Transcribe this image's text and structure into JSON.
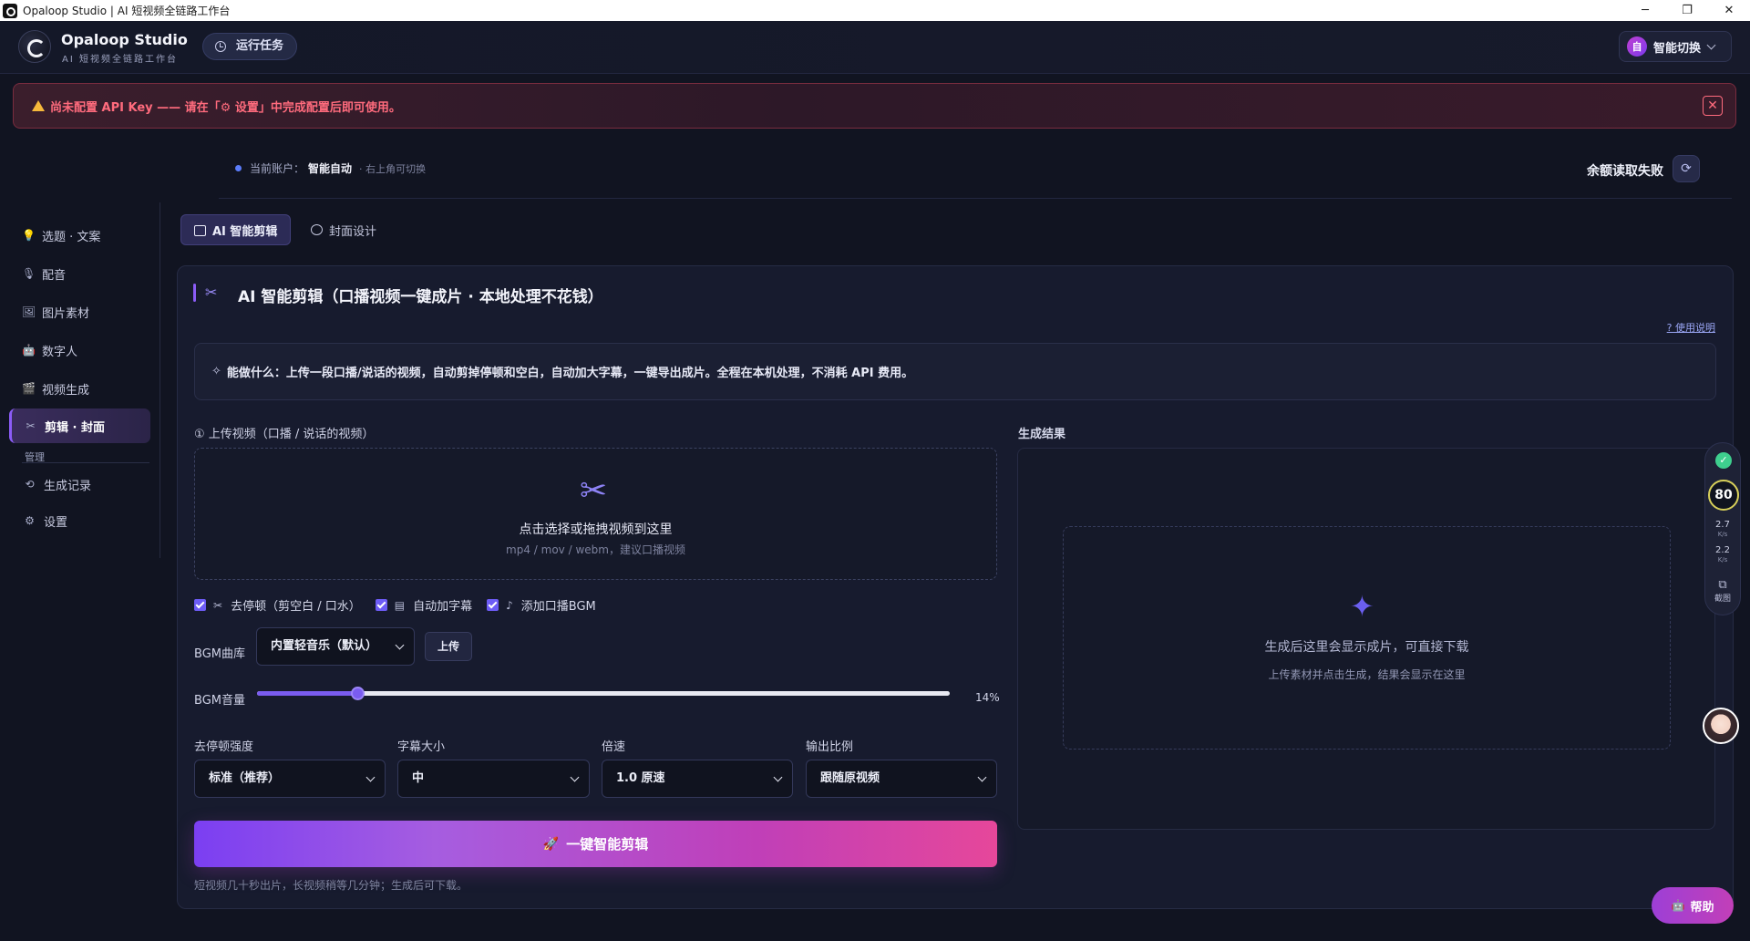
{
  "window": {
    "title": "Opaloop Studio | AI 短视频全链路工作台",
    "controls": [
      "─",
      "❐",
      "✕"
    ]
  },
  "header": {
    "brand_name": "Opaloop Studio",
    "brand_sub": "AI 短视频全链路工作台",
    "run_task": "运行任务",
    "account_badge": "自",
    "account_switch": "智能切换"
  },
  "alert": {
    "text": "尚未配置 API Key —— 请在「⚙ 设置」中完成配置后即可使用。",
    "close": "✕"
  },
  "account_bar": {
    "label": "当前账户：",
    "name": "智能自动",
    "hint": "· 右上角可切换",
    "balance": "余额读取失败",
    "refresh": "⟳"
  },
  "sidebar": {
    "items": [
      {
        "label": "选题 · 文案",
        "icon": "💡"
      },
      {
        "label": "配音",
        "icon": "🎙"
      },
      {
        "label": "图片素材",
        "icon": "🖼"
      },
      {
        "label": "数字人",
        "icon": "🤖"
      },
      {
        "label": "视频生成",
        "icon": "🎬"
      },
      {
        "label": "剪辑 · 封面",
        "icon": "✂"
      }
    ],
    "section": "管理",
    "manage_items": [
      {
        "label": "生成记录",
        "icon": "⟲"
      },
      {
        "label": "设置",
        "icon": "⚙"
      }
    ]
  },
  "tabs": [
    {
      "label": "AI 智能剪辑"
    },
    {
      "label": "封面设计"
    }
  ],
  "panel": {
    "title": "AI 智能剪辑（口播视频一键成片 · 本地处理不花钱）",
    "help_link": "? 使用说明",
    "info": "能做什么：上传一段口播/说话的视频，自动剪掉停顿和空白，自动加大字幕，一键导出成片。全程在本机处理，不消耗 API 费用。",
    "upload_label": "① 上传视频（口播 / 说话的视频）",
    "upload_main": "点击选择或拖拽视频到这里",
    "upload_sub": "mp4 / mov / webm，建议口播视频",
    "checks": [
      {
        "label": "去停顿（剪空白 / 口水）",
        "checked": true
      },
      {
        "label": "自动加字幕",
        "checked": true
      },
      {
        "label": "添加口播BGM",
        "checked": true
      }
    ],
    "bgm_label": "BGM曲库",
    "bgm_select": "内置轻音乐（默认）",
    "bgm_upload": "上传",
    "volume_label": "BGM音量",
    "volume_value": "14%",
    "volume_fraction": 0.145,
    "params": [
      {
        "label": "去停顿强度",
        "value": "标准（推荐）"
      },
      {
        "label": "字幕大小",
        "value": "中"
      },
      {
        "label": "倍速",
        "value": "1.0 原速"
      },
      {
        "label": "输出比例",
        "value": "跟随原视频"
      }
    ],
    "primary_button": "一键智能剪辑",
    "footnote": "短视频几十秒出片，长视频稍等几分钟；生成后可下载。",
    "result_label": "生成结果",
    "result_main": "生成后这里会显示成片，可直接下载",
    "result_sub": "上传素材并点击生成，结果会显示在这里"
  },
  "floatbar": {
    "score": "80",
    "up_speed": "2.7",
    "down_speed": "2.2",
    "speed_unit": "K/s",
    "screenshot": "截图"
  },
  "help_button": "帮助",
  "colors": {
    "accent": "#7b3ff2",
    "accent_pink": "#e6479a",
    "alert_red": "#ff6b7d",
    "background": "#111421"
  }
}
